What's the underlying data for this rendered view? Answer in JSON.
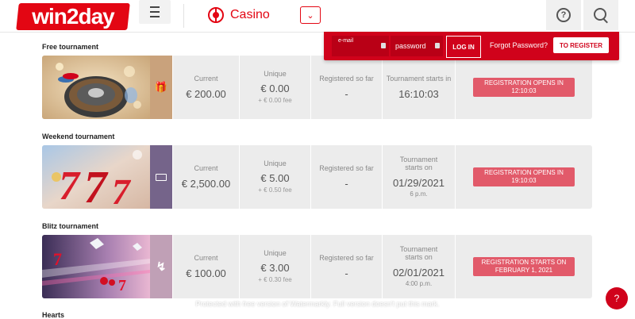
{
  "header": {
    "logo_text": "win2day",
    "section_label": "Casino",
    "brand_color": "#e30613"
  },
  "login": {
    "email_placeholder": "e-mail",
    "password_placeholder": "password",
    "login_label": "LOG IN",
    "forgot_label": "Forgot Password?",
    "register_label": "TO REGISTER"
  },
  "tournaments": [
    {
      "title": "Free tournament",
      "current_label": "Current",
      "current_value": "€ 200.00",
      "unique_label": "Unique",
      "unique_value": "€ 0.00",
      "unique_fee": "+ € 0.00 fee",
      "registered_label": "Registered so far",
      "registered_value": "-",
      "start_label": "Tournament starts in",
      "start_value": "16:10:03",
      "start_sub": "",
      "cta_label": "REGISTRATION OPENS IN 12:10:03",
      "badge_icon": "gift-icon"
    },
    {
      "title": "Weekend tournament",
      "current_label": "Current",
      "current_value": "€ 2,500.00",
      "unique_label": "Unique",
      "unique_value": "€ 5.00",
      "unique_fee": "+ € 0.50 fee",
      "registered_label": "Registered so far",
      "registered_value": "-",
      "start_label": "Tournament starts on",
      "start_value": "01/29/2021",
      "start_sub": "6 p.m.",
      "cta_label": "REGISTRATION OPENS IN 19:10:03",
      "badge_icon": "cash-icon"
    },
    {
      "title": "Blitz tournament",
      "current_label": "Current",
      "current_value": "€ 100.00",
      "unique_label": "Unique",
      "unique_value": "€ 3.00",
      "unique_fee": "+ € 0.30 fee",
      "registered_label": "Registered so far",
      "registered_value": "-",
      "start_label": "Tournament starts on",
      "start_value": "02/01/2021",
      "start_sub": "4:00 p.m.",
      "cta_label": "REGISTRATION STARTS ON FEBRUARY 1, 2021",
      "badge_icon": "lightning-icon"
    }
  ],
  "next_section_title": "Hearts",
  "footer_notice": "Protected with free version of Watermarkly. Full version doesn't put this mark."
}
